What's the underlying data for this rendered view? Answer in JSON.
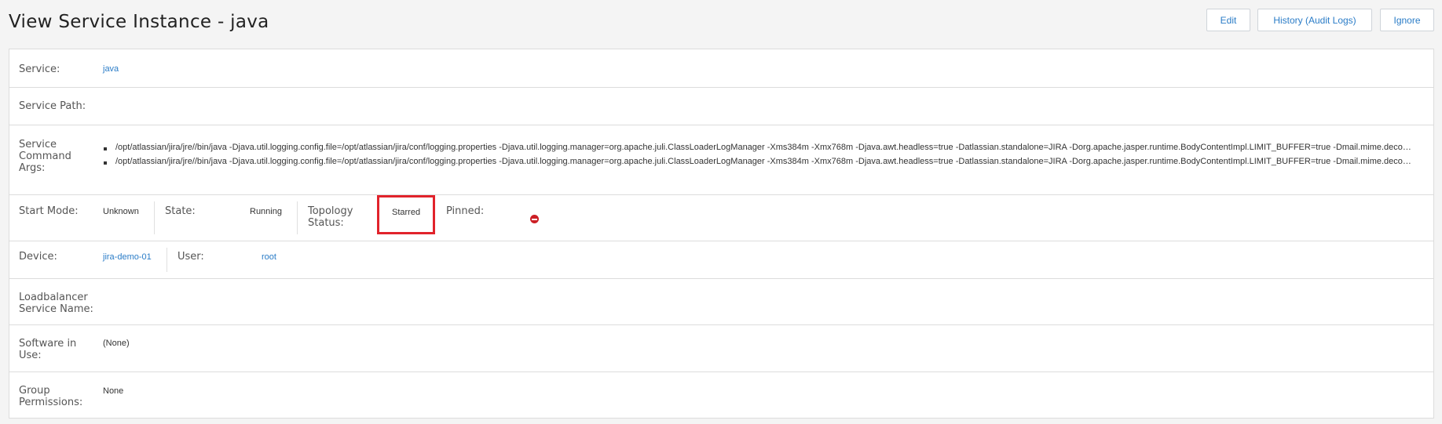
{
  "header": {
    "title": "View Service Instance - java",
    "buttons": {
      "edit": "Edit",
      "history": "History (Audit Logs)",
      "ignore": "Ignore"
    }
  },
  "fields": {
    "service": {
      "label": "Service:",
      "value": "java"
    },
    "service_path": {
      "label": "Service Path:",
      "value": ""
    },
    "command_args": {
      "label": "Service Command Args:",
      "items": [
        "/opt/atlassian/jira/jre//bin/java -Djava.util.logging.config.file=/opt/atlassian/jira/conf/logging.properties -Djava.util.logging.manager=org.apache.juli.ClassLoaderLogManager -Xms384m -Xmx768m -Djava.awt.headless=true -Datlassian.standalone=JIRA -Dorg.apache.jasper.runtime.BodyContentImpl.LIMIT_BUFFER=true -Dmail.mime.decodeparameters=true",
        "/opt/atlassian/jira/jre//bin/java -Djava.util.logging.config.file=/opt/atlassian/jira/conf/logging.properties -Djava.util.logging.manager=org.apache.juli.ClassLoaderLogManager -Xms384m -Xmx768m -Djava.awt.headless=true -Datlassian.standalone=JIRA -Dorg.apache.jasper.runtime.BodyContentImpl.LIMIT_BUFFER=true -Dmail.mime.decodeparameters=true"
      ]
    },
    "start_mode": {
      "label": "Start Mode:",
      "value": "Unknown"
    },
    "state": {
      "label": "State:",
      "value": "Running"
    },
    "topology_status": {
      "label_line1": "Topology",
      "label_line2": "Status:",
      "value": "Starred"
    },
    "pinned": {
      "label": "Pinned:",
      "icon": "remove-circle-icon",
      "icon_color": "#cc1f25"
    },
    "device": {
      "label": "Device:",
      "value": "jira-demo-01"
    },
    "user": {
      "label": "User:",
      "value": "root"
    },
    "loadbalancer": {
      "label_line1": "Loadbalancer",
      "label_line2": "Service Name:",
      "value": ""
    },
    "software": {
      "label_line1": "Software in",
      "label_line2": "Use:",
      "value": "(None)"
    },
    "group_permissions": {
      "label_line1": "Group",
      "label_line2": "Permissions:",
      "value": "None"
    }
  },
  "colors": {
    "link": "#2a7cc7",
    "highlight": "#e1232b"
  }
}
